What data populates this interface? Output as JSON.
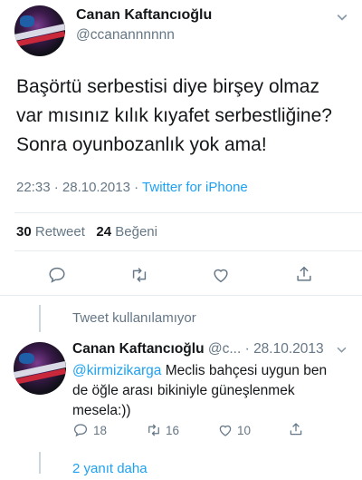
{
  "tweet": {
    "author_name": "Canan Kaftancıoğlu",
    "author_handle": "@ccanannnnnn",
    "text_line1": "Başörtü serbestisi diye birşey olmaz",
    "text_line2": "var mısınız kılık kıyafet serbestliğine?",
    "text_line3": "Sonra oyunbozanlık yok ama!",
    "time": "22:33",
    "separator": "·",
    "date": "28.10.2013",
    "source": "Twitter for iPhone",
    "retweet_count": "30",
    "retweet_label": "Retweet",
    "like_count": "24",
    "like_label": "Beğeni"
  },
  "unavailable": {
    "text": "Tweet kullanılamıyor"
  },
  "reply": {
    "author_name": "Canan Kaftancıoğlu",
    "author_handle": "@c...",
    "separator": "·",
    "date": "28.10.2013",
    "mention": "@kirmizikarga",
    "text_part1": " Meclis bahçesi uygun ben",
    "text_line2": "de öğle arası bikiniyle güneşlenmek",
    "text_line3": "mesela:))",
    "reply_count": "18",
    "retweet_count": "16",
    "like_count": "10",
    "more_replies": "2 yanıt daha"
  },
  "icons": [
    "chevron-down-icon",
    "reply-icon",
    "retweet-icon",
    "like-icon",
    "share-icon"
  ],
  "colors": {
    "accent": "#1da1f2",
    "muted": "#657786",
    "text": "#14171a",
    "divider": "#e6ecf0"
  }
}
